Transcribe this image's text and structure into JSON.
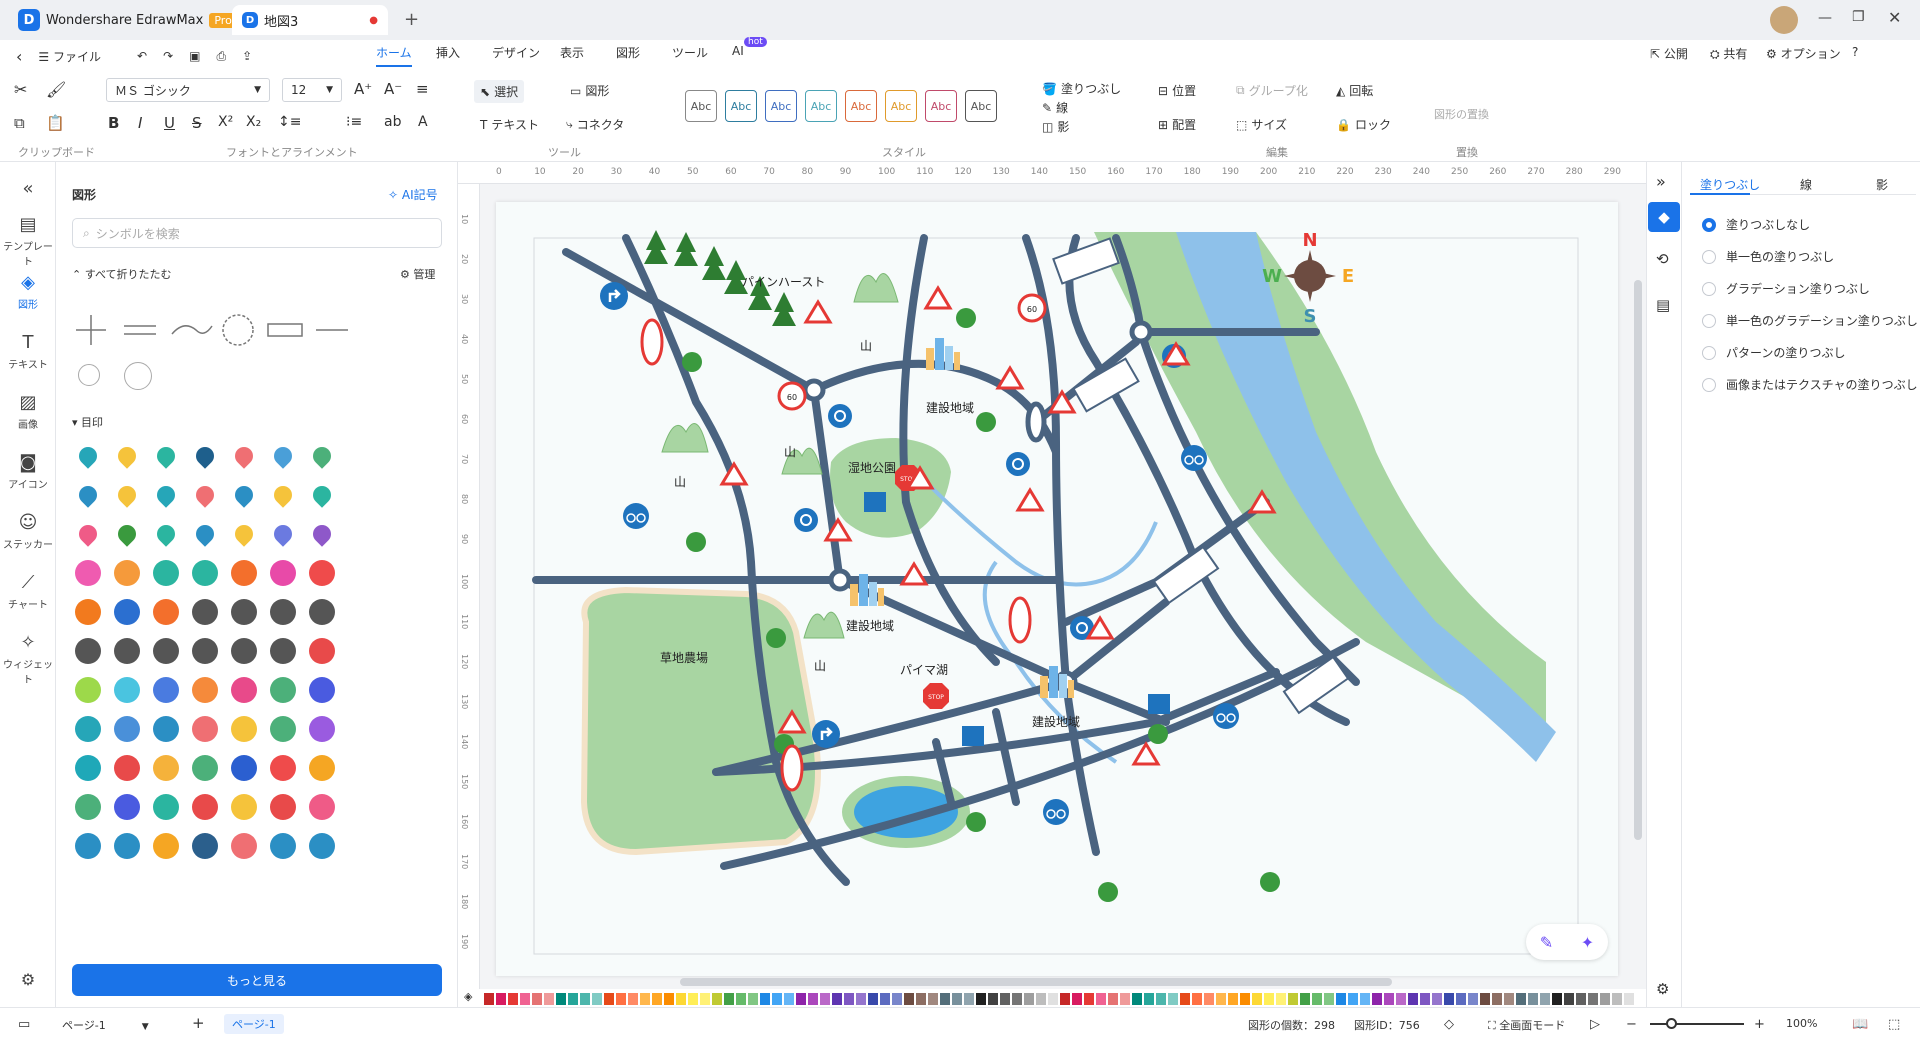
{
  "app": {
    "name": "Wondershare EdrawMax",
    "badge": "Pro",
    "doc_tab": "地図3"
  },
  "menubar": {
    "file": "ファイル",
    "tabs": [
      "ホーム",
      "挿入",
      "デザイン",
      "表示",
      "図形",
      "ツール",
      "AI"
    ],
    "ai_badge": "hot",
    "right": [
      "公開",
      "共有",
      "オプション"
    ]
  },
  "ribbon": {
    "font_name": "ＭＳ ゴシック",
    "font_size": "12",
    "select": "選択",
    "shape": "図形",
    "text": "テキスト",
    "connector": "コネクタ",
    "style_sample": "Abc",
    "fill": "塗りつぶし",
    "line": "線",
    "shadow": "影",
    "position": "位置",
    "align": "配置",
    "group": "グループ化",
    "size": "サイズ",
    "rotate": "回転",
    "lock": "ロック",
    "replace_shape": "図形の置換",
    "groups": [
      "クリップボード",
      "フォントとアラインメント",
      "ツール",
      "スタイル",
      "編集",
      "置換"
    ]
  },
  "leftnav": [
    "テンプレート",
    "図形",
    "テキスト",
    "画像",
    "アイコン",
    "ステッカー",
    "チャート",
    "ウィジェット"
  ],
  "shapes": {
    "title": "図形",
    "ai_link": "AI記号",
    "search_placeholder": "シンボルを検索",
    "collapse_all": "すべて折りたたむ",
    "manage": "管理",
    "section": "目印",
    "more": "もっと見る"
  },
  "map": {
    "labels": [
      "パインハースト",
      "山",
      "山",
      "山",
      "山",
      "建設地域",
      "建設地域",
      "建設地域",
      "湿地公園",
      "草地農場",
      "パイマ湖"
    ],
    "stop": "STOP",
    "speed": "60",
    "compass": {
      "n": "N",
      "s": "S",
      "e": "E",
      "w": "W"
    }
  },
  "rulers": {
    "top": [
      "0",
      "10",
      "20",
      "30",
      "40",
      "50",
      "60",
      "70",
      "80",
      "90",
      "100",
      "110",
      "120",
      "130",
      "140",
      "150",
      "160",
      "170",
      "180",
      "190",
      "200",
      "210",
      "220",
      "230",
      "240",
      "250",
      "260",
      "270",
      "280",
      "290"
    ],
    "left": [
      "10",
      "20",
      "30",
      "40",
      "50",
      "60",
      "70",
      "80",
      "90",
      "100",
      "110",
      "120",
      "130",
      "140",
      "150",
      "160",
      "170",
      "180",
      "190"
    ]
  },
  "rightpanel": {
    "tabs": [
      "塗りつぶし",
      "線",
      "影"
    ],
    "options": [
      "塗りつぶしなし",
      "単一色の塗りつぶし",
      "グラデーション塗りつぶし",
      "単一色のグラデーション塗りつぶし",
      "パターンの塗りつぶし",
      "画像またはテクスチャの塗りつぶし"
    ]
  },
  "status": {
    "page_select": "ページ-1",
    "page_tab": "ページ-1",
    "shape_count": "図形の個数：298",
    "shape_id": "図形ID：756",
    "fullscreen": "全画面モード",
    "zoom": "100%"
  },
  "colors": {
    "accent": "#1a73e8",
    "road": "#4a6380",
    "grass": "#a8d5a2",
    "water": "#8ec1ea"
  }
}
